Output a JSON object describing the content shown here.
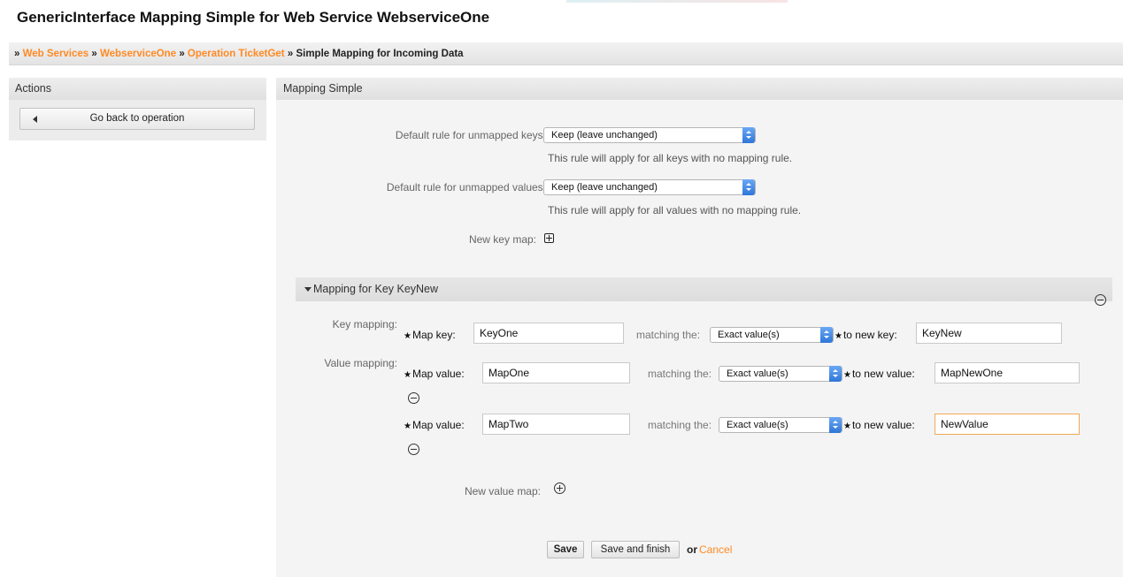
{
  "page": {
    "title": "GenericInterface Mapping Simple for Web Service WebserviceOne"
  },
  "breadcrumb": {
    "sep": "»",
    "items": [
      "Web Services",
      "WebserviceOne",
      "Operation TicketGet"
    ],
    "current": "Simple Mapping for Incoming Data"
  },
  "sidebar": {
    "title": "Actions",
    "back_label": "Go back to operation"
  },
  "main": {
    "title": "Mapping Simple",
    "default_keys": {
      "label": "Default rule for unmapped keys:",
      "value": "Keep (leave unchanged)",
      "hint": "This rule will apply for all keys with no mapping rule."
    },
    "default_values": {
      "label": "Default rule for unmapped values:",
      "value": "Keep (leave unchanged)",
      "hint": "This rule will apply for all values with no mapping rule."
    },
    "new_key_map_label": "New key map:",
    "key_section": {
      "title": "Mapping for Key KeyNew",
      "key_mapping_label": "Key mapping:",
      "value_mapping_label": "Value mapping:",
      "star": "★",
      "map_key_label": "Map key:",
      "map_key_value": "KeyOne",
      "matching_label": "matching the:",
      "match_option": "Exact value(s)",
      "to_new_key_label": "to new key:",
      "new_key_value": "KeyNew",
      "map_value_label": "Map value:",
      "to_new_value_label": "to new value:",
      "value_rows": [
        {
          "map_value": "MapOne",
          "new_value": "MapNewOne"
        },
        {
          "map_value": "MapTwo",
          "new_value": "NewValue"
        }
      ],
      "new_value_map_label": "New value map:"
    },
    "footer": {
      "save": "Save",
      "save_finish": "Save and finish",
      "or": "or",
      "cancel": "Cancel"
    }
  },
  "colors": {
    "link": "#ff8a25",
    "panel": "#f4f4f4",
    "focus_border": "#f0a95a"
  }
}
